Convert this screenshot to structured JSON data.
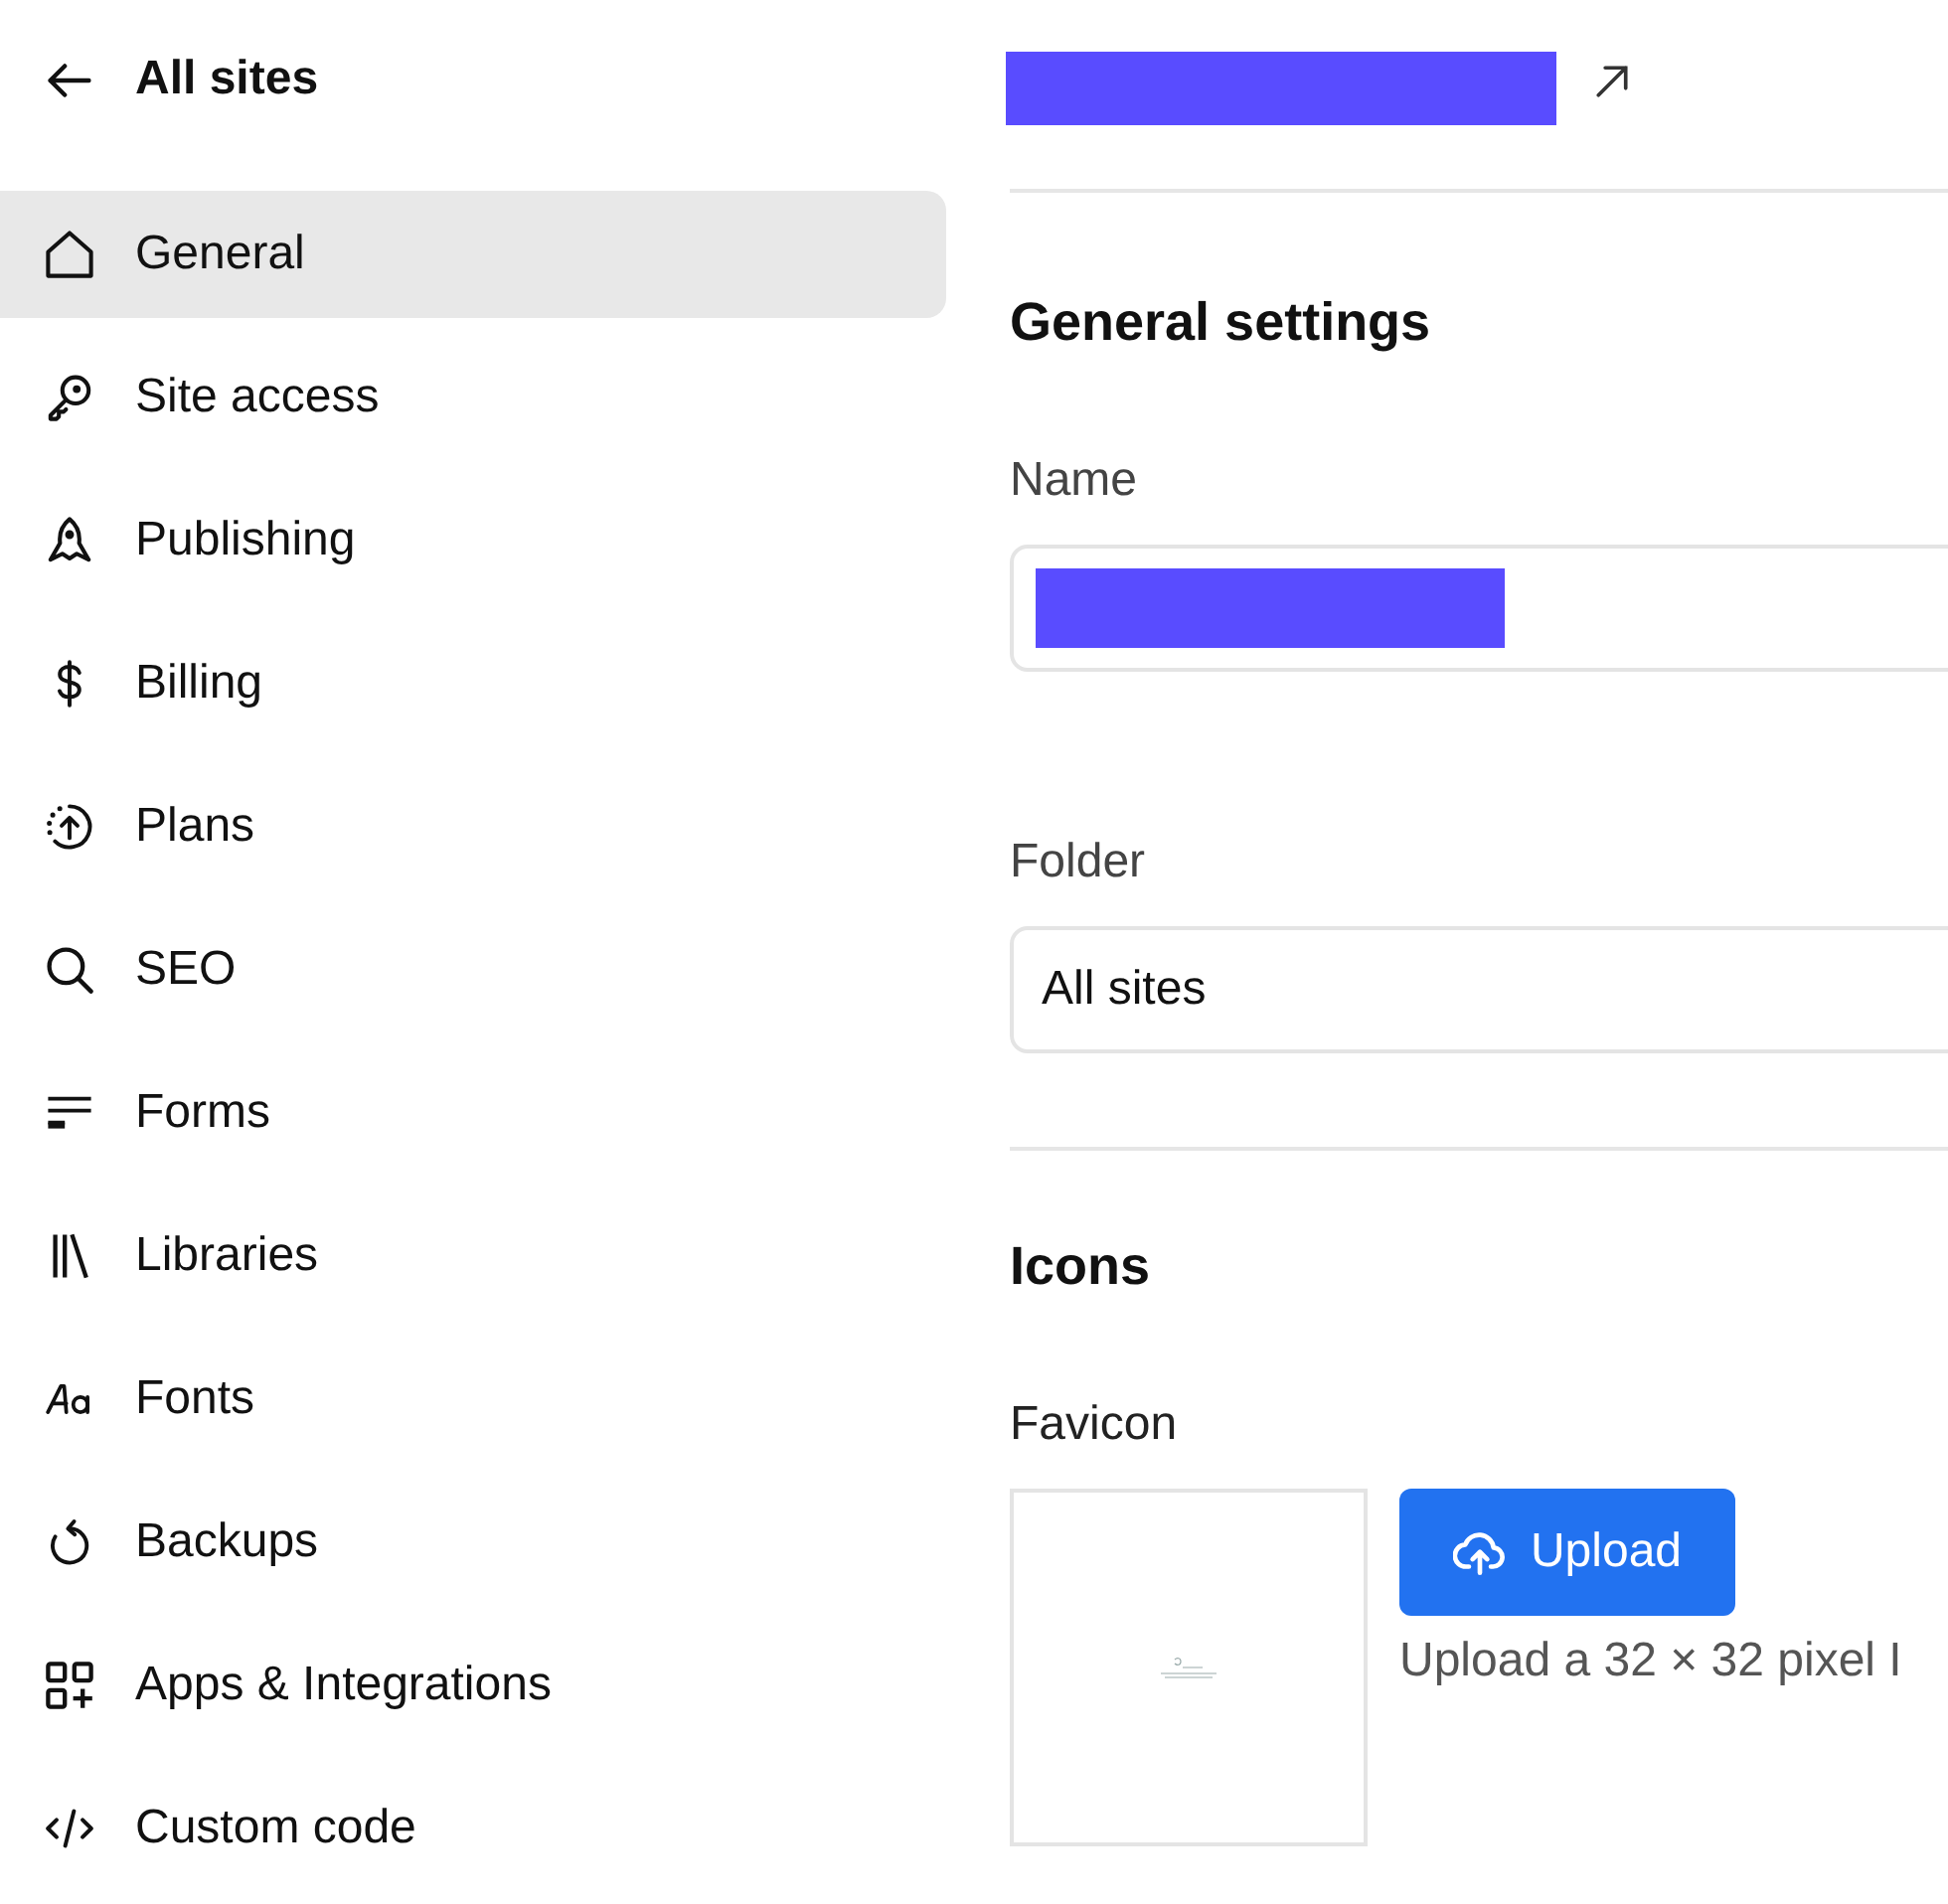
{
  "back_link": {
    "label": "All sites"
  },
  "sidebar": {
    "items": [
      {
        "label": "General",
        "kind": "home",
        "selected": true
      },
      {
        "label": "Site access",
        "kind": "key",
        "selected": false
      },
      {
        "label": "Publishing",
        "kind": "rocket",
        "selected": false
      },
      {
        "label": "Billing",
        "kind": "dollar",
        "selected": false
      },
      {
        "label": "Plans",
        "kind": "upgrade",
        "selected": false
      },
      {
        "label": "SEO",
        "kind": "search",
        "selected": false
      },
      {
        "label": "Forms",
        "kind": "forms",
        "selected": false
      },
      {
        "label": "Libraries",
        "kind": "libraries",
        "selected": false
      },
      {
        "label": "Fonts",
        "kind": "fonts",
        "selected": false
      },
      {
        "label": "Backups",
        "kind": "backup",
        "selected": false
      },
      {
        "label": "Apps & Integrations",
        "kind": "apps",
        "selected": false
      },
      {
        "label": "Custom code",
        "kind": "code",
        "selected": false
      }
    ]
  },
  "general_settings": {
    "title": "General settings",
    "fields": [
      {
        "label": "Name",
        "kind": "redacted"
      },
      {
        "label": "Folder",
        "kind": "text",
        "value": "All sites"
      }
    ]
  },
  "icons_section": {
    "title": "Icons",
    "favicon": {
      "label": "Favicon",
      "button": "Upload",
      "hint": "Upload a 32 × 32 pixel I"
    }
  }
}
